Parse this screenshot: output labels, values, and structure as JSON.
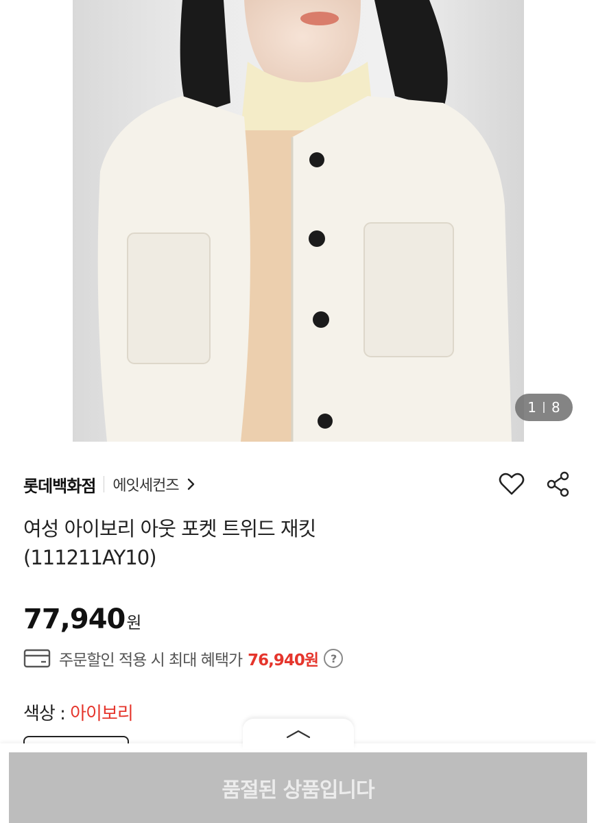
{
  "gallery": {
    "current": "1",
    "total": "8"
  },
  "brand": {
    "name": "롯데백화점",
    "store": "에잇세컨즈"
  },
  "product": {
    "title_line1": "여성 아이보리 아웃 포켓 트위드 재킷",
    "title_line2": "(111211AY10)",
    "price": "77,940",
    "price_unit": "원"
  },
  "benefit": {
    "text": "주문할인 적용 시 최대 혜택가",
    "amount": "76,940원",
    "help": "?"
  },
  "option": {
    "label": "색상 : ",
    "value": "아이보리"
  },
  "purchase": {
    "button_label": "품절된 상품입니다"
  },
  "colors": {
    "accent_red": "#e5352c",
    "soldout_bg": "#bdbdbd"
  }
}
